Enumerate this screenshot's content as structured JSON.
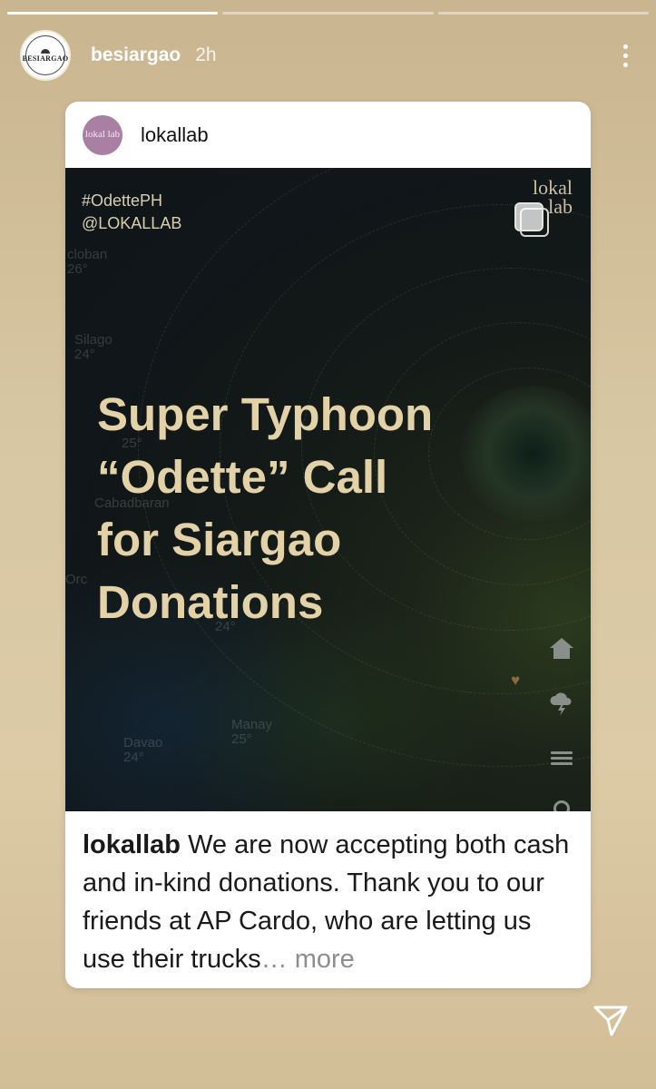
{
  "story": {
    "progress": [
      1.0,
      0.0,
      0.0
    ],
    "username": "besiargao",
    "time_ago": "2h",
    "avatar_logo_text": "BESIARGAO"
  },
  "post": {
    "username": "lokallab",
    "avatar_text": "lokal lab",
    "image": {
      "hashtag": "#OdettePH",
      "handle": "@LOKALLAB",
      "brand_logo_text": "lokal lab",
      "headline_lines": [
        "Super Typhoon",
        "“Odette” Call",
        "for Siargao",
        "Donations"
      ],
      "map_labels": [
        {
          "name": "cloban",
          "temp": "26°"
        },
        {
          "name": "Silago",
          "temp": "24°"
        },
        {
          "name": "",
          "temp": "25°"
        },
        {
          "name": "Cabadbaran",
          "temp": ""
        },
        {
          "name": "Orc",
          "temp": ""
        },
        {
          "name": "",
          "temp": "24°"
        },
        {
          "name": "Manay",
          "temp": "25°"
        },
        {
          "name": "Davao",
          "temp": "24°"
        }
      ]
    },
    "caption": {
      "username": "lokallab",
      "text": "We are now accepting both cash and in-kind donations. Thank you to our friends at AP Cardo, who are letting us use their trucks",
      "ellipsis": "…",
      "more_label": "more"
    }
  },
  "icons": {
    "more": "more-vertical-icon",
    "share": "send-icon",
    "map_home": "home-icon",
    "map_weather": "cloud-lightning-icon",
    "map_menu": "hamburger-menu-icon",
    "map_search": "search-icon",
    "map_heart": "heart-icon"
  },
  "colors": {
    "headline": "#e3d2a8",
    "background": "#d8c7a3",
    "caption_more": "#8e8e8e"
  }
}
